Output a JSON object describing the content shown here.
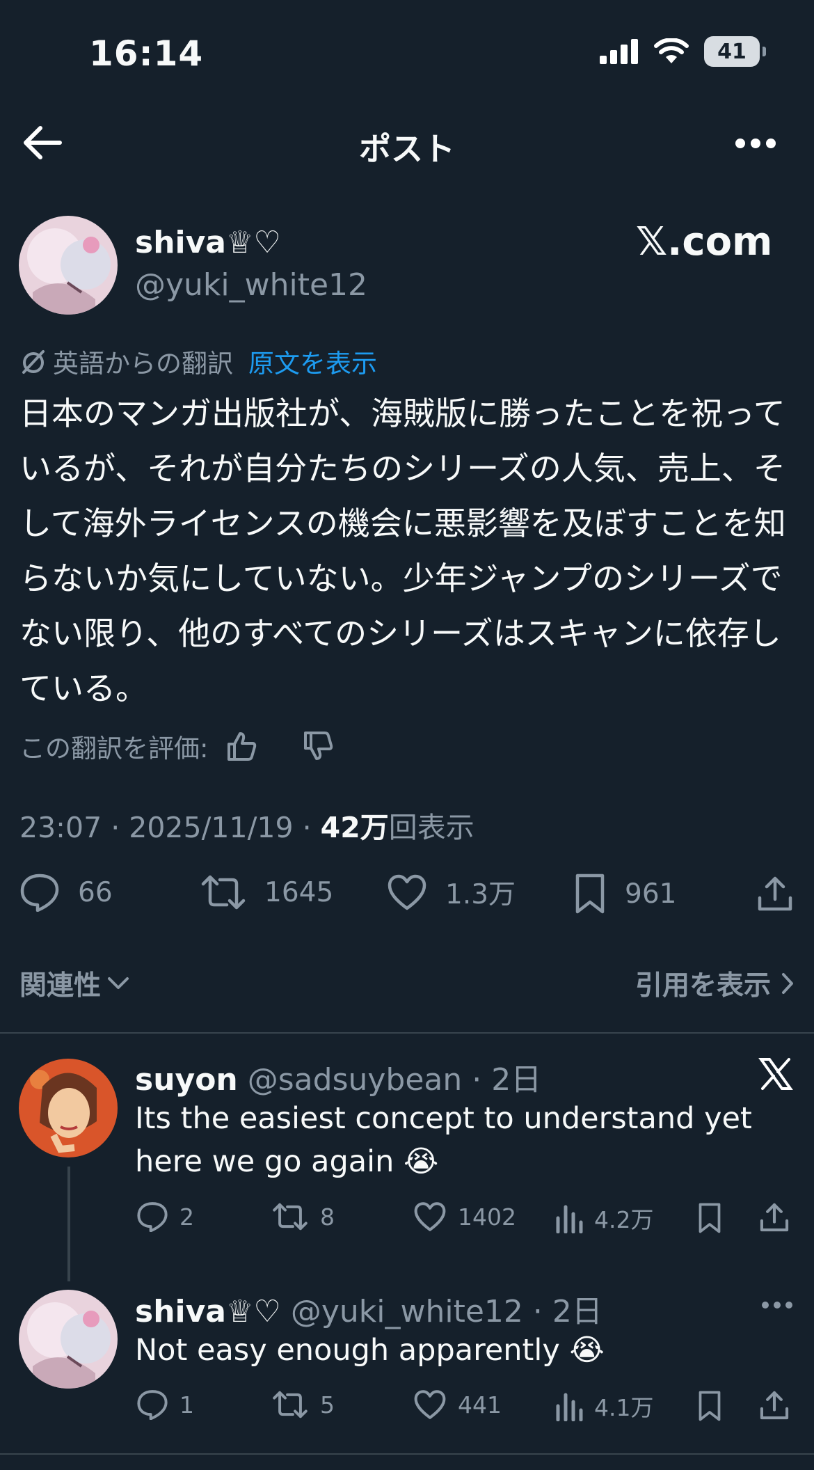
{
  "status_bar": {
    "time": "16:14",
    "battery": "41"
  },
  "header": {
    "title": "ポスト"
  },
  "post": {
    "author_name": "shiva♕♡",
    "author_handle": "@yuki_white12",
    "watermark": "𝕏.com",
    "translation_label": "英語からの翻訳",
    "show_original": "原文を表示",
    "body": "日本のマンガ出版社が、海賊版に勝ったことを祝っているが、それが自分たちのシリーズの人気、売上、そして海外ライセンスの機会に悪影響を及ぼすことを知らないか気にしていない。少年ジャンプのシリーズでない限り、他のすべてのシリーズはスキャンに依存している。",
    "rate_translation": "この翻訳を評価:",
    "timestamp": "23:07 · 2025/11/19 · ",
    "views_count": "42万",
    "views_label": "回表示",
    "stats": {
      "replies": "66",
      "reposts": "1645",
      "likes": "1.3万",
      "bookmarks": "961"
    }
  },
  "sort": {
    "label": "関連性",
    "quotes_label": "引用を表示"
  },
  "replies": [
    {
      "name": "suyon",
      "handle": "@sadsuybean",
      "time": "· 2日",
      "text": "Its the easiest concept to understand yet here we go again 😭",
      "stats": {
        "replies": "2",
        "reposts": "8",
        "likes": "1402",
        "views": "4.2万"
      }
    },
    {
      "name": "shiva♕♡",
      "handle": "@yuki_white12",
      "time": "· 2日",
      "text": "Not easy enough apparently 😭",
      "stats": {
        "replies": "1",
        "reposts": "5",
        "likes": "441",
        "views": "4.1万"
      }
    }
  ],
  "colors": {
    "background": "#15202b",
    "muted": "#8b98a5",
    "link": "#1d9bf0",
    "divider": "#38444d"
  }
}
